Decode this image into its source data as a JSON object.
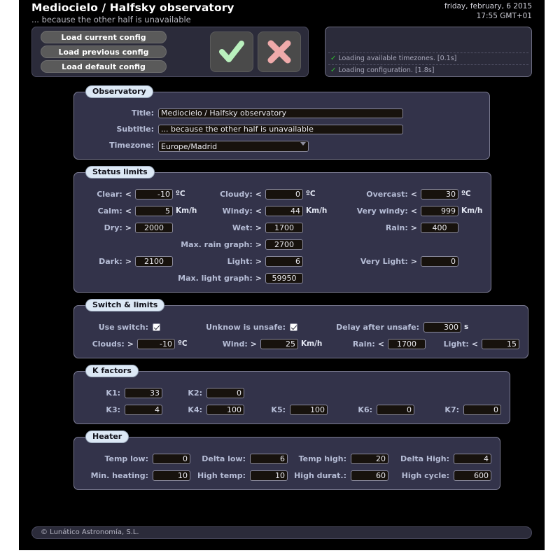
{
  "header": {
    "title": "Mediocielo / Halfsky observatory",
    "subtitle": "... because the other half is unavailable",
    "date": "friday, february, 6 2015",
    "time": "17:55 GMT+01",
    "buttons": {
      "load_current": "Load current config",
      "load_previous": "Load previous config",
      "load_default": "Load default config",
      "accept_icon": "check-mark",
      "cancel_icon": "cross-mark"
    },
    "accept_color": "#b9f0bd",
    "cancel_color": "#efaaaa",
    "log": [
      {
        "icon": "check",
        "text": "Loading available timezones. [0.1s]"
      },
      {
        "icon": "check",
        "text": "Loading configuration. [1.8s]"
      }
    ]
  },
  "observatory": {
    "legend": "Observatory",
    "title_label": "Title:",
    "title_value": "Mediocielo / Halfsky observatory",
    "subtitle_label": "Subtitle:",
    "subtitle_value": "... because the other half is unavailable",
    "timezone_label": "Timezone:",
    "timezone_value": "Europe/Madrid",
    "timezone_options": [
      "Europe/Madrid"
    ]
  },
  "status_limits": {
    "legend": "Status limits",
    "fields": [
      {
        "label": "Clear:",
        "op": "<",
        "value": "-10",
        "unit": "ºC"
      },
      {
        "label": "Cloudy:",
        "op": "<",
        "value": "0",
        "unit": "ºC"
      },
      {
        "label": "Overcast:",
        "op": "<",
        "value": "30",
        "unit": "ºC"
      },
      {
        "label": "Calm:",
        "op": "<",
        "value": "5",
        "unit": "Km/h"
      },
      {
        "label": "Windy:",
        "op": "<",
        "value": "44",
        "unit": "Km/h"
      },
      {
        "label": "Very windy:",
        "op": "<",
        "value": "999",
        "unit": "Km/h"
      },
      {
        "label": "Dry:",
        "op": ">",
        "value": "2000",
        "unit": ""
      },
      {
        "label": "Wet:",
        "op": ">",
        "value": "1700",
        "unit": ""
      },
      {
        "label": "Rain:",
        "op": ">",
        "value": "400",
        "unit": ""
      },
      {
        "label": "Max. rain graph:",
        "op": ">",
        "value": "2700",
        "unit": ""
      },
      {
        "label": "Dark:",
        "op": ">",
        "value": "2100",
        "unit": ""
      },
      {
        "label": "Light:",
        "op": ">",
        "value": "6",
        "unit": ""
      },
      {
        "label": "Very Light:",
        "op": ">",
        "value": "0",
        "unit": ""
      },
      {
        "label": "Max. light graph:",
        "op": ">",
        "value": "59950",
        "unit": ""
      }
    ]
  },
  "switch_limits": {
    "legend": "Switch & limits",
    "use_switch_label": "Use switch:",
    "use_switch_checked": true,
    "unknown_unsafe_label": "Unknow is unsafe:",
    "unknown_unsafe_checked": true,
    "delay_label": "Delay after unsafe:",
    "delay_value": "300",
    "delay_unit": "s",
    "fields": [
      {
        "label": "Clouds:",
        "op": ">",
        "value": "-10",
        "unit": "ºC"
      },
      {
        "label": "Wind:",
        "op": ">",
        "value": "25",
        "unit": "Km/h"
      },
      {
        "label": "Rain:",
        "op": "<",
        "value": "1700",
        "unit": ""
      },
      {
        "label": "Light:",
        "op": "<",
        "value": "15",
        "unit": ""
      }
    ]
  },
  "k_factors": {
    "legend": "K factors",
    "fields": [
      {
        "label": "K1:",
        "value": "33"
      },
      {
        "label": "K2:",
        "value": "0"
      },
      {
        "label": "K3:",
        "value": "4"
      },
      {
        "label": "K4:",
        "value": "100"
      },
      {
        "label": "K5:",
        "value": "100"
      },
      {
        "label": "K6:",
        "value": "0"
      },
      {
        "label": "K7:",
        "value": "0"
      }
    ]
  },
  "heater": {
    "legend": "Heater",
    "fields": [
      {
        "label": "Temp low:",
        "value": "0"
      },
      {
        "label": "Delta low:",
        "value": "6"
      },
      {
        "label": "Temp high:",
        "value": "20"
      },
      {
        "label": "Delta High:",
        "value": "4"
      },
      {
        "label": "Min. heating:",
        "value": "10"
      },
      {
        "label": "High temp:",
        "value": "10"
      },
      {
        "label": "High durat.:",
        "value": "60"
      },
      {
        "label": "High cycle:",
        "value": "600"
      }
    ]
  },
  "footer": {
    "copyright": "© Lunático Astronomía, S.L."
  }
}
